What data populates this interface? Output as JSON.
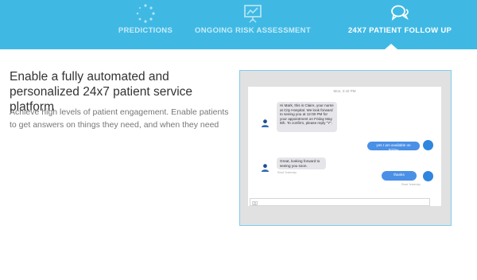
{
  "nav": {
    "tabs": [
      {
        "label": "PREDICTIONS",
        "icon": "loading-circle-icon",
        "active": false
      },
      {
        "label": "ONGOING RISK ASSESSMENT",
        "icon": "presentation-chart-icon",
        "active": false
      },
      {
        "label": "24X7 PATIENT FOLLOW UP",
        "icon": "chat-bubbles-icon",
        "active": true
      }
    ],
    "background_color": "#3fb9e4"
  },
  "hero": {
    "headline": "Enable a fully automated and personalized 24x7 patient service platform",
    "subtext": "Achieve high levels of patient engagement. Enable patients to get answers on things they need, and when they need"
  },
  "chat": {
    "timestamp": "Mon, 2:42 PM",
    "messages": [
      {
        "from": "bot",
        "text": "Hi Mark, this is Claire, your nurse at City Hospital. We look forward to seeing you at 12:00 PM for your appointment on Friday May 6th. To confirm, please reply \"Y\".",
        "icon": "nurse-avatar-icon"
      },
      {
        "from": "user",
        "text": "yes I am available on Friday",
        "icon": "patient-avatar-icon"
      },
      {
        "from": "bot",
        "text": "Great, looking forward to seeing you soon.",
        "meta": "Read Yesterday",
        "icon": "nurse-avatar-icon"
      },
      {
        "from": "user",
        "text": "thanks",
        "meta": "Read Yesterday",
        "icon": "patient-avatar-icon"
      }
    ],
    "composer_icon": "camera-icon",
    "bubble_out_color": "#4a90e6",
    "bubble_in_color": "#e5e5ea"
  }
}
